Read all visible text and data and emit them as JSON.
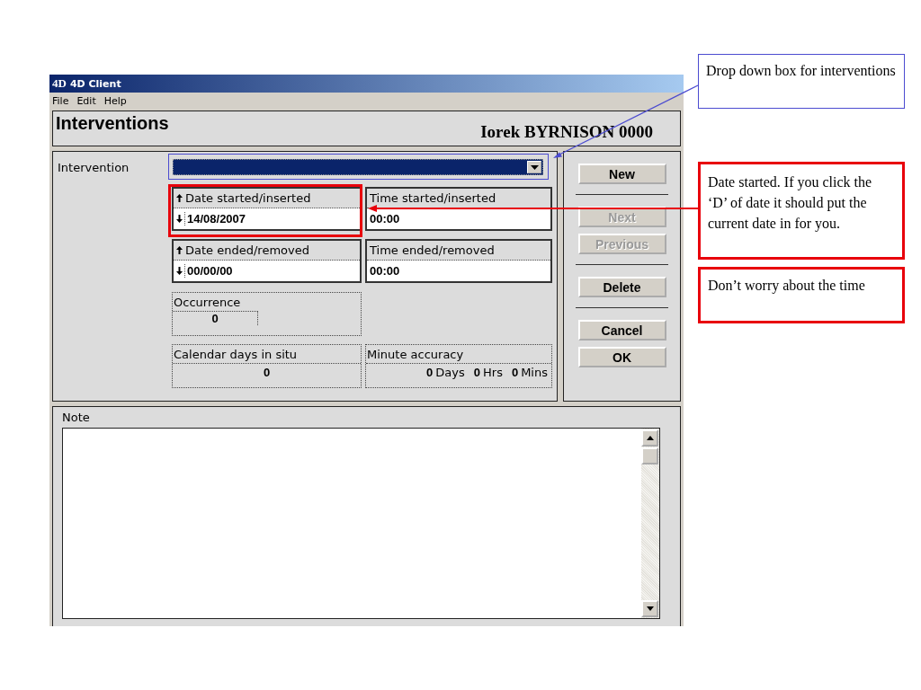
{
  "window": {
    "logo": "4D",
    "title": "4D Client"
  },
  "menu": [
    "File",
    "Edit",
    "Help"
  ],
  "header": {
    "title": "Interventions",
    "patient": "Iorek BYRNISON  0000"
  },
  "form": {
    "intervention_label": "Intervention",
    "date_fields": [
      {
        "kind": "date",
        "label": "Date started/inserted",
        "value": "14/08/2007"
      },
      {
        "kind": "time",
        "label": "Time started/inserted",
        "value": "00:00"
      },
      {
        "kind": "date",
        "label": "Date ended/removed",
        "value": "00/00/00"
      },
      {
        "kind": "time",
        "label": "Time ended/removed",
        "value": "00:00"
      }
    ],
    "occurrence": {
      "label": "Occurrence",
      "value": "0"
    },
    "calendar_days": {
      "label": "Calendar days in situ",
      "value": "0"
    },
    "minute_accuracy": {
      "label": "Minute accuracy",
      "parts": [
        {
          "value": "0",
          "unit": "Days"
        },
        {
          "value": "0",
          "unit": "Hrs"
        },
        {
          "value": "0",
          "unit": "Mins"
        }
      ]
    }
  },
  "button_groups": [
    [
      {
        "label": "New",
        "disabled": false
      }
    ],
    [
      {
        "label": "Next",
        "disabled": true
      },
      {
        "label": "Previous",
        "disabled": true
      }
    ],
    [
      {
        "label": "Delete",
        "disabled": false
      }
    ],
    [
      {
        "label": "Cancel",
        "disabled": false
      },
      {
        "label": "OK",
        "disabled": false
      }
    ]
  ],
  "note": {
    "label": "Note"
  },
  "annotations": [
    {
      "text": "Drop down box for interventions",
      "color": "#4b4bd0"
    },
    {
      "text": "Date started. If you click the ‘D’ of date it should put the current date in for you.",
      "color": "#e8000b"
    },
    {
      "text": "Don’t worry about the time",
      "color": "#e8000b"
    }
  ]
}
